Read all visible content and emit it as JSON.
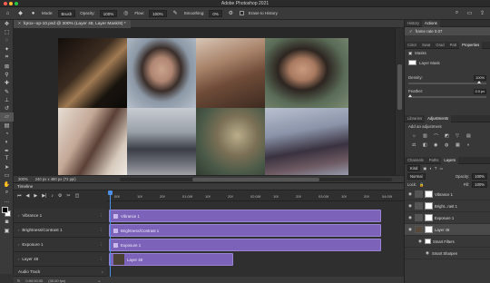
{
  "app": {
    "title": "Adobe Photoshop 2021",
    "traffic_lights": [
      "#ff5f57",
      "#febc2e",
      "#28c840"
    ]
  },
  "options_bar": {
    "mode_label": "Mode:",
    "mode_value": "Brush",
    "opacity_label": "Opacity:",
    "opacity_value": "100%",
    "flow_label": "Flow:",
    "flow_value": "100%",
    "smoothing_label": "Smoothing:",
    "smoothing_value": "0%",
    "erase_label": "Erase to History"
  },
  "document": {
    "tab_title": "fqrox--op-10.psd @ 300% (Layer 48, Layer Mask/8) *",
    "status_zoom": "300%",
    "status_dims": "240 px x 480 px (72 ppi)"
  },
  "canvas_photos": [
    {
      "name": "photo-concert-couple",
      "color": "#2a2118"
    },
    {
      "name": "photo-woman-portrait",
      "color": "#8f9aa5"
    },
    {
      "name": "photo-hands-closeup",
      "color": "#7a5a45"
    },
    {
      "name": "photo-young-man-smiling",
      "color": "#5b6a55"
    },
    {
      "name": "photo-couple-lying",
      "color": "#c8b3a3"
    },
    {
      "name": "photo-street-crowd",
      "color": "#8a8e96"
    },
    {
      "name": "photo-wicker-basket",
      "color": "#6b6a54"
    },
    {
      "name": "photo-man-sitting",
      "color": "#6e7488"
    }
  ],
  "timeline": {
    "title": "Timeline",
    "ruler_ticks": [
      "00f",
      "10f",
      "20f",
      "01:00f",
      "10f",
      "20f",
      "02:00f",
      "10f",
      "20f",
      "03:00f",
      "10f",
      "20f",
      "04:00f"
    ],
    "tracks": [
      {
        "label": "Vibrance 1",
        "clip_label": "Vibrance 1"
      },
      {
        "label": "Brightness/Contrast 1",
        "clip_label": "Brightness/Contrast 1"
      },
      {
        "label": "Exposure 1",
        "clip_label": "Exposure 1"
      },
      {
        "label": "Layer 48",
        "clip_label": "Layer 48"
      }
    ],
    "audio_label": "Audio Track",
    "footer_time": "0:00:00:00",
    "footer_fps": "(30.00 fps)"
  },
  "right_panel": {
    "history_tabs": [
      "History",
      "Actions"
    ],
    "history_item": "frame rate 0.07",
    "props_tabs": [
      "Color",
      "Swat",
      "Grad",
      "Patt",
      "Properties"
    ],
    "props_masks_label": "Masks",
    "props_layer_mask": "Layer Mask",
    "density_label": "Density:",
    "density_value": "100%",
    "feather_label": "Feather:",
    "feather_value": "0.0 px",
    "adj_tabs": [
      "Libraries",
      "Adjustments"
    ],
    "adj_hint": "Add an adjustment",
    "layers_tabs": [
      "Channels",
      "Paths",
      "Layers"
    ],
    "kind_label": "Kind",
    "blend_mode": "Normal",
    "opacity_label": "Opacity:",
    "opacity_value": "100%",
    "lock_label": "Lock:",
    "fill_label": "Fill:",
    "fill_value": "100%",
    "layers": [
      {
        "name": "Vibrance 1",
        "selected": false
      },
      {
        "name": "Bright...rast 1",
        "selected": false
      },
      {
        "name": "Exposure 1",
        "selected": false
      },
      {
        "name": "Layer 48",
        "selected": true
      }
    ],
    "smart_filters": "Smart Filters",
    "smart_sharpen": "Smart Sharpen"
  }
}
